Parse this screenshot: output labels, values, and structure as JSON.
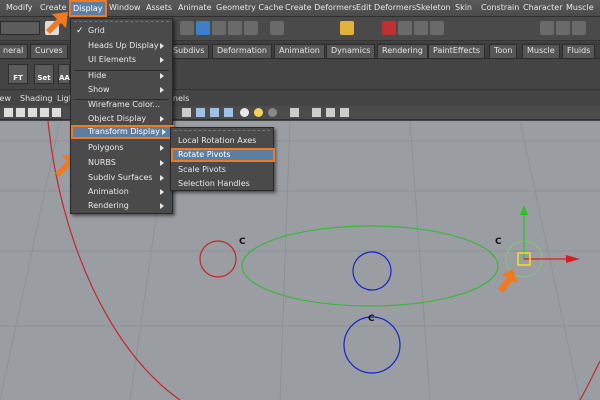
{
  "menubar": {
    "items": [
      "Modify",
      "Create",
      "Display",
      "Window",
      "Assets",
      "Animate",
      "Geometry Cache",
      "Create Deformers",
      "Edit Deformers",
      "Skeleton",
      "Skin",
      "Constrain",
      "Character",
      "Muscle"
    ],
    "active": "Display"
  },
  "shelf_tabs": [
    "neral",
    "Curves",
    "Subdivs",
    "Deformation",
    "Animation",
    "Dynamics",
    "Rendering",
    "PaintEffects",
    "Toon",
    "Muscle",
    "Fluids"
  ],
  "shelf_buttons": [
    "FT",
    "Set",
    "AA"
  ],
  "panel_menu": [
    "View",
    "Shading",
    "Ligh",
    "anels"
  ],
  "display_menu": {
    "items": [
      {
        "label": "Grid",
        "checked": true,
        "submenu": false
      },
      {
        "label": "Heads Up Display",
        "submenu": true
      },
      {
        "label": "UI Elements",
        "submenu": true
      },
      {
        "label": "Hide",
        "submenu": true
      },
      {
        "label": "Show",
        "submenu": true
      },
      {
        "label": "Wireframe Color...",
        "submenu": false
      },
      {
        "label": "Object Display",
        "submenu": true
      },
      {
        "label": "Transform Display",
        "submenu": true,
        "highlighted": true
      },
      {
        "label": "Polygons",
        "submenu": true
      },
      {
        "label": "NURBS",
        "submenu": true
      },
      {
        "label": "Subdiv Surfaces",
        "submenu": true
      },
      {
        "label": "Animation",
        "submenu": true
      },
      {
        "label": "Rendering",
        "submenu": true
      }
    ]
  },
  "transform_submenu": {
    "items": [
      {
        "label": "Local Rotation Axes"
      },
      {
        "label": "Rotate Pivots",
        "highlighted": true
      },
      {
        "label": "Scale Pivots"
      },
      {
        "label": "Selection Handles"
      }
    ]
  },
  "viewport": {
    "labels": [
      "C",
      "C",
      "C"
    ],
    "colors": {
      "red_curve": "#c0282c",
      "green_ellipse": "#3cb43c",
      "blue_circle": "#1a22c8",
      "highlight": "#f07a22",
      "menu_highlight": "#5e7ea0"
    }
  }
}
